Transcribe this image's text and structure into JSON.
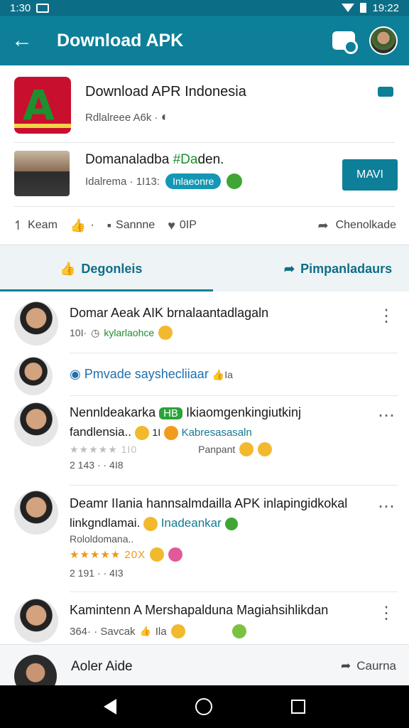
{
  "statusbar": {
    "time_left": "1:30",
    "time_right": "19:22"
  },
  "appbar": {
    "back_icon": "arrow-left",
    "title": "Download APK",
    "chat_icon": "chat-bubble",
    "avatar": "profile-avatar"
  },
  "app": {
    "title": "Download APR Indonesia",
    "subtitle": "Rdlalreee  A6k ·"
  },
  "featured": {
    "title_prefix": "Domanaladba ",
    "title_green": "#Da",
    "title_suffix": "den.",
    "meta": "Idalrema · 1I13:",
    "tag": "Inlaeonre",
    "button": "MAVI"
  },
  "actions": {
    "item1": "Keam",
    "item3": "Sannne",
    "item4": "0IP",
    "share": "Chenolkade"
  },
  "tabs": [
    {
      "label": "Degonleis",
      "icon": "thumbs-up"
    },
    {
      "label": "Pimpanladaurs",
      "icon": "share-arrow"
    }
  ],
  "posts": [
    {
      "name": "Domar Aeak AIK brnalaantadlagaln",
      "meta_a": "10I·",
      "meta_b": "kylarlaohce"
    },
    {
      "name": "Pmvade sayshecliiaar",
      "meta_b": "Ia"
    },
    {
      "name": "Nennldeakarka",
      "badge": "HB",
      "name_rest": "Ikiaomgenkingiutkinj",
      "line2": "fandlensia..",
      "line2_b": "1I",
      "line2_c": "Kabresasasaln",
      "rating": "★★★★★ 1I0",
      "extra": "Panpant",
      "meta": "2 143 · · 4I8"
    },
    {
      "name": "Deamr IIania hannsalmdailla APK inlapingidkokal",
      "line2": "linkgndlamai.",
      "line2_c": "Inadeankar",
      "sub": "Rololdomana..",
      "rating": "★★★★★ 20X",
      "meta": "2 191 · · 4I3"
    },
    {
      "name": "Kamintenn A Mershapalduna Magiahsihlikdan",
      "meta": "364· · Savcak",
      "meta_b": "Ila"
    }
  ],
  "bottom": {
    "name": "Aoler Aide",
    "share": "Caurna"
  }
}
